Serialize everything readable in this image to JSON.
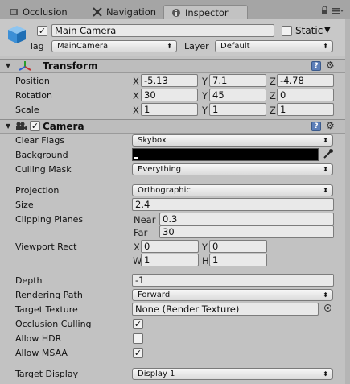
{
  "tabs": [
    {
      "label": "Occlusion",
      "icon": "occlusion-icon"
    },
    {
      "label": "Navigation",
      "icon": "navigation-icon"
    },
    {
      "label": "Inspector",
      "icon": "inspector-icon",
      "active": true
    }
  ],
  "window_controls": {
    "lock": "lock-icon",
    "menu": "context-menu-icon"
  },
  "object": {
    "name": "Main Camera",
    "active": true,
    "static_label": "Static",
    "static": false,
    "tag_label": "Tag",
    "tag": "MainCamera",
    "layer_label": "Layer",
    "layer": "Default"
  },
  "transform": {
    "title": "Transform",
    "position": {
      "label": "Position",
      "x": "-5.13",
      "y": "7.1",
      "z": "-4.78"
    },
    "rotation": {
      "label": "Rotation",
      "x": "30",
      "y": "45",
      "z": "0"
    },
    "scale": {
      "label": "Scale",
      "x": "1",
      "y": "1",
      "z": "1"
    }
  },
  "axis": {
    "x": "X",
    "y": "Y",
    "z": "Z",
    "w": "W",
    "h": "H"
  },
  "camera": {
    "title": "Camera",
    "enabled": true,
    "clear_flags": {
      "label": "Clear Flags",
      "value": "Skybox"
    },
    "background": {
      "label": "Background",
      "color": "#000000"
    },
    "culling_mask": {
      "label": "Culling Mask",
      "value": "Everything"
    },
    "projection": {
      "label": "Projection",
      "value": "Orthographic"
    },
    "size": {
      "label": "Size",
      "value": "2.4"
    },
    "clipping": {
      "label": "Clipping Planes",
      "near_label": "Near",
      "near": "0.3",
      "far_label": "Far",
      "far": "30"
    },
    "viewport": {
      "label": "Viewport Rect",
      "x": "0",
      "y": "0",
      "w": "1",
      "h": "1"
    },
    "depth": {
      "label": "Depth",
      "value": "-1"
    },
    "rendering_path": {
      "label": "Rendering Path",
      "value": "Forward"
    },
    "target_texture": {
      "label": "Target Texture",
      "value": "None (Render Texture)"
    },
    "occlusion_culling": {
      "label": "Occlusion Culling",
      "checked": true
    },
    "allow_hdr": {
      "label": "Allow HDR",
      "checked": false
    },
    "allow_msaa": {
      "label": "Allow MSAA",
      "checked": true
    },
    "target_display": {
      "label": "Target Display",
      "value": "Display 1"
    }
  },
  "colors": {
    "panel": "#c2c2c2",
    "tabbar": "#a5a5a5",
    "field": "#e9e9e9",
    "help": "#5d7fb8"
  }
}
